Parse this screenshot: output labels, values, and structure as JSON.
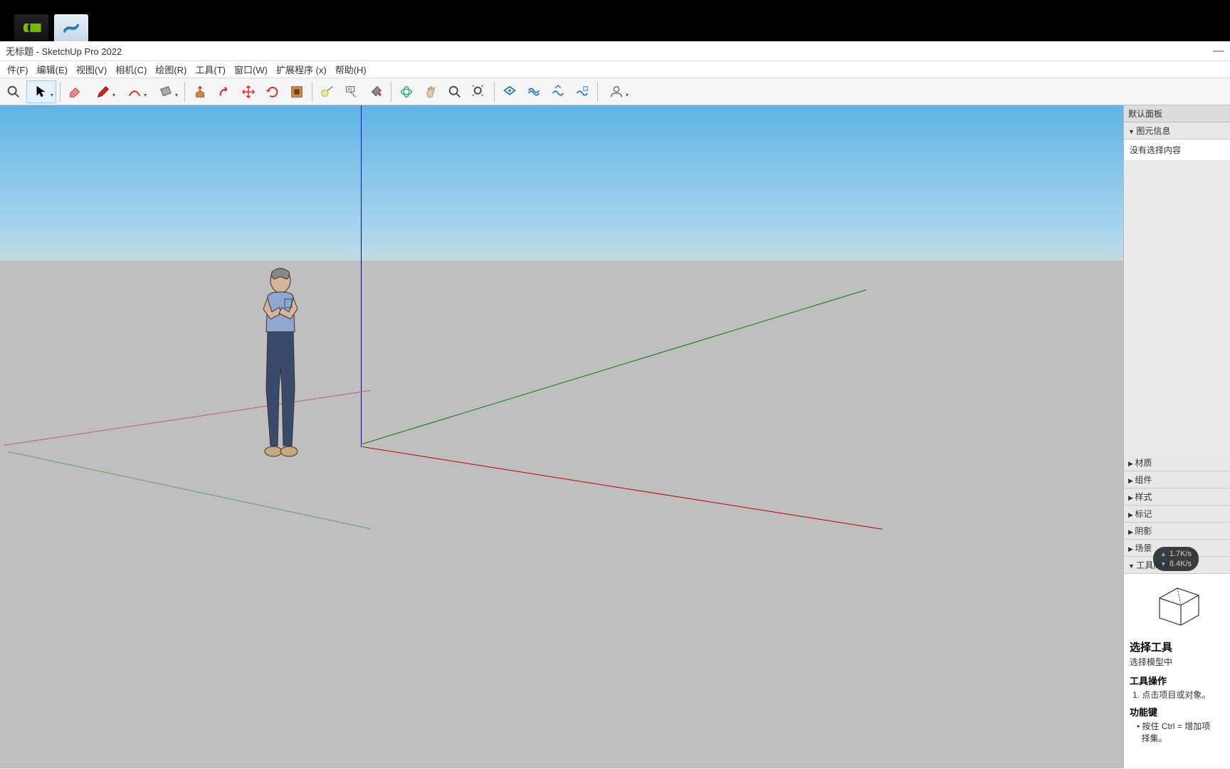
{
  "window": {
    "title": "无标题 - SketchUp Pro 2022"
  },
  "menu": {
    "file": "件(F)",
    "edit": "编辑(E)",
    "view": "视图(V)",
    "camera": "相机(C)",
    "draw": "绘图(R)",
    "tools": "工具(T)",
    "window": "窗口(W)",
    "extensions": "扩展程序 (x)",
    "help": "帮助(H)"
  },
  "toolbar": {
    "tools": [
      "zoom",
      "select",
      "eraser",
      "pencil",
      "arc",
      "rectangle",
      "pushpull",
      "followme",
      "move",
      "rotate",
      "scale",
      "tapemeasure",
      "text",
      "paintbucket",
      "orbit",
      "pan",
      "zoom2",
      "zoomextents",
      "warehouse",
      "layers",
      "outliner",
      "extension",
      "user"
    ]
  },
  "panel": {
    "default_title": "默认面板",
    "entity_info": "图元信息",
    "entity_empty": "没有选择内容",
    "sections": {
      "materials": "材质",
      "components": "组件",
      "styles": "样式",
      "tags": "标记",
      "shadows": "阴影",
      "scenes": "场景",
      "instructor": "工具向导"
    }
  },
  "instructor": {
    "title": "选择工具",
    "subtitle": "选择模型中",
    "op_title": "工具操作",
    "op_step1": "1. 点击项目或对象。",
    "fn_title": "功能键",
    "fn_text": "按住 Ctrl = 增加项",
    "fn_text2": "择集。"
  },
  "net": {
    "up": "1.7K/s",
    "down": "8.4K/s"
  }
}
